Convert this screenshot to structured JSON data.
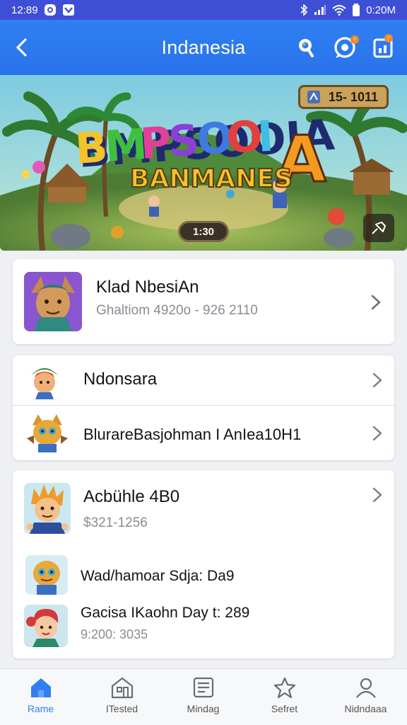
{
  "status_bar": {
    "time": "12:89",
    "right_time": "0:20M"
  },
  "header": {
    "title": "Indanesia",
    "icons": [
      "back-arrow-icon",
      "search-icon",
      "chat-icon",
      "calendar-icon"
    ]
  },
  "banner": {
    "game_title_line1": "BMPSOOIA",
    "game_title_line2": "BANMANES",
    "score": "15- 1011",
    "timer": "1:30"
  },
  "list": [
    {
      "title": "Klad NbesiAn",
      "subtitle": "Ghaltiom 4920o - 926 2110"
    },
    {
      "title": "Ndonsara"
    },
    {
      "title": "BlurareBasjohman I AnIea10H1"
    },
    {
      "title": "Acbühle 4B0",
      "subtitle": "$321-1256"
    },
    {
      "title": "Wad/hamoar Sdja: Da9"
    },
    {
      "title": "Gacisa IKaohn Day t: 289",
      "subtitle": "9:200: 3035"
    }
  ],
  "bottom_nav": [
    {
      "label": "Rame",
      "icon": "home-icon",
      "active": true
    },
    {
      "label": "ITested",
      "icon": "store-icon",
      "active": false
    },
    {
      "label": "Mindag",
      "icon": "document-icon",
      "active": false
    },
    {
      "label": "Sefret",
      "icon": "star-icon",
      "active": false
    },
    {
      "label": "Nidndaaa",
      "icon": "profile-icon",
      "active": false
    }
  ],
  "colors": {
    "accent": "#2f7ff3",
    "status_bar": "#3e4fd6"
  }
}
